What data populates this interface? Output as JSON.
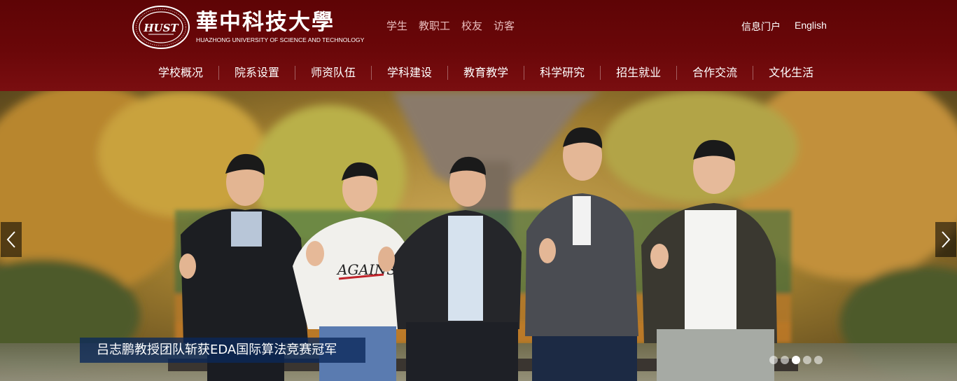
{
  "logo": {
    "name_cn": "華中科技大學",
    "name_en": "HUAZHONG UNIVERSITY OF SCIENCE AND TECHNOLOGY",
    "seal_text": "华中科技大学 HUAZHONG UNIVERSITY OF SCIENCE AND TECHNOLOGY",
    "seal_monogram": "HUST"
  },
  "audience_links": [
    "学生",
    "教职工",
    "校友",
    "访客"
  ],
  "top_links": [
    "信息门户",
    "English"
  ],
  "nav": [
    "学校概况",
    "院系设置",
    "师资队伍",
    "学科建设",
    "教育教学",
    "科学研究",
    "招生就业",
    "合作交流",
    "文化生活"
  ],
  "slider": {
    "caption": "吕志鹏教授团队斩获EDA国际算法竞赛冠军",
    "dot_count": 5,
    "active_index": 2,
    "prev_icon": "chevron-left-icon",
    "next_icon": "chevron-right-icon",
    "shirt_text": "AGAINST"
  },
  "colors": {
    "header_bg": "#6a0709",
    "caption_bg": "#0a285a",
    "audience_text": "#e8bcbc"
  }
}
